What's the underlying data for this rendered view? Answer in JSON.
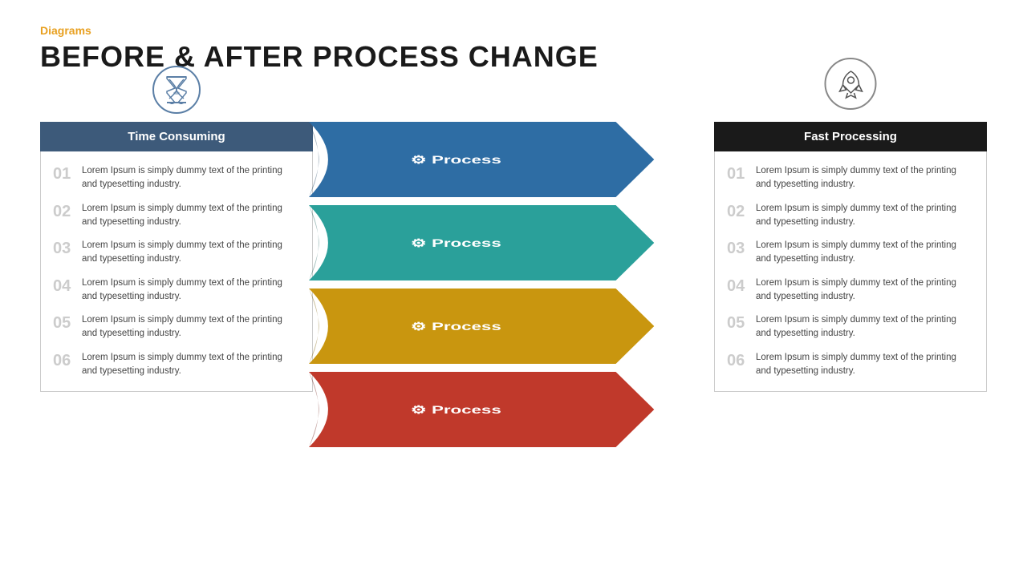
{
  "header": {
    "category": "Diagrams",
    "title": "BEFORE & AFTER PROCESS CHANGE"
  },
  "left_panel": {
    "title": "Time Consuming",
    "items": [
      {
        "number": "01",
        "text": "Lorem Ipsum is simply dummy text of the printing and typesetting industry."
      },
      {
        "number": "02",
        "text": "Lorem Ipsum is simply dummy text of the printing and typesetting industry."
      },
      {
        "number": "03",
        "text": "Lorem Ipsum is simply dummy text of the printing and typesetting industry."
      },
      {
        "number": "04",
        "text": "Lorem Ipsum is simply dummy text of the printing and typesetting industry."
      },
      {
        "number": "05",
        "text": "Lorem Ipsum is simply dummy text of the printing and typesetting industry."
      },
      {
        "number": "06",
        "text": "Lorem Ipsum is simply dummy text of the printing and typesetting industry."
      }
    ]
  },
  "arrows": [
    {
      "label": "Process",
      "color": "#2e6da4",
      "color_dark": "#1f4e7a"
    },
    {
      "label": "Process",
      "color": "#2aa09a",
      "color_dark": "#1d7a75"
    },
    {
      "label": "Process",
      "color": "#d4a017",
      "color_dark": "#a87a0f"
    },
    {
      "label": "Process",
      "color": "#c0392b",
      "color_dark": "#962d22"
    }
  ],
  "right_panel": {
    "title": "Fast Processing",
    "items": [
      {
        "number": "01",
        "text": "Lorem Ipsum is simply dummy text of the printing and typesetting industry."
      },
      {
        "number": "02",
        "text": "Lorem Ipsum is simply dummy text of the printing and typesetting industry."
      },
      {
        "number": "03",
        "text": "Lorem Ipsum is simply dummy text of the printing and typesetting industry."
      },
      {
        "number": "04",
        "text": "Lorem Ipsum is simply dummy text of the printing and typesetting industry."
      },
      {
        "number": "05",
        "text": "Lorem Ipsum is simply dummy text of the printing and typesetting industry."
      },
      {
        "number": "06",
        "text": "Lorem Ipsum is simply dummy text of the printing and typesetting industry."
      }
    ]
  },
  "icons": {
    "hourglass": "⧗",
    "rocket": "🚀",
    "gear": "⚙"
  },
  "colors": {
    "orange": "#E8A020",
    "dark_blue_header": "#3d5a7a",
    "black_header": "#1a1a1a",
    "border_gray": "#cccccc"
  }
}
